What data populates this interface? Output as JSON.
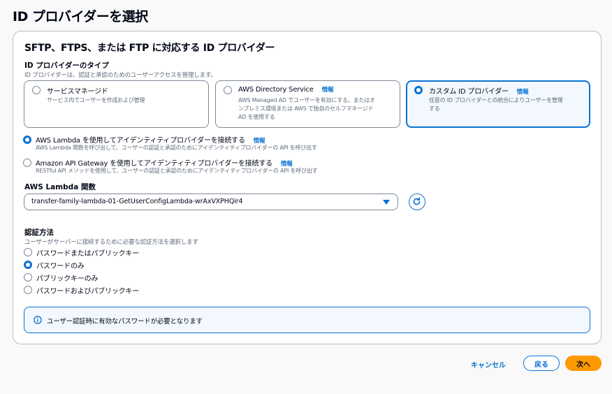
{
  "page": {
    "title": "ID プロバイダーを選択"
  },
  "panel": {
    "title": "SFTP、FTPS、または FTP に対応する ID プロバイダー"
  },
  "provider_type": {
    "label": "ID プロバイダーのタイプ",
    "description": "ID プロバイダーは、認証と承認のためのユーザーアクセスを管理します。",
    "cards": [
      {
        "title": "サービスマネージド",
        "info": "",
        "desc_lines": [
          "サービス内でユーザーを作成および管理"
        ],
        "selected": false
      },
      {
        "title": "AWS Directory Service",
        "info": "情報",
        "desc_lines": [
          "AWS Managed AD でユーザーを有効にする、またはオ",
          "ンプレミス環境または AWS で独自のセルフマネージド",
          "AD を使用する"
        ],
        "selected": false
      },
      {
        "title": "カスタム ID プロバイダー",
        "info": "情報",
        "desc_lines": [
          "任意の ID プロバイダーとの統合によりユーザーを管理",
          "する"
        ],
        "selected": true
      }
    ]
  },
  "connection_options": [
    {
      "title": "AWS Lambda を使用してアイデンティティプロバイダーを接続する",
      "info": "情報",
      "desc": "AWS Lambda 関数を呼び出して、ユーザーの認証と承認のためにアイデンティティプロバイダーの API を呼び出す",
      "selected": true
    },
    {
      "title": "Amazon API Gateway を使用してアイデンティティプロバイダーを接続する",
      "info": "情報",
      "desc": "RESTful API メソッドを使用して、ユーザーの認証と承認のためにアイデンティティプロバイダーの API を呼び出す",
      "selected": false
    }
  ],
  "lambda": {
    "label": "AWS Lambda 関数",
    "selected_value": "transfer-family-lambda-01-GetUserConfigLambda-wrAxVXPHQir4"
  },
  "auth_method": {
    "label": "認証方法",
    "description": "ユーザーがサーバーに接続するために必要な認証方法を選択します",
    "options": [
      {
        "label": "パスワードまたはパブリックキー",
        "selected": false
      },
      {
        "label": "パスワードのみ",
        "selected": true
      },
      {
        "label": "パブリックキーのみ",
        "selected": false
      },
      {
        "label": "パスワードおよびパブリックキー",
        "selected": false
      }
    ]
  },
  "alert": {
    "text": "ユーザー認証時に有効なパスワードが必要となります",
    "icon": "info-icon"
  },
  "footer": {
    "cancel": "キャンセル",
    "back": "戻る",
    "next": "次へ"
  },
  "colors": {
    "accent": "#0972d3",
    "primary_button": "#ff9900",
    "border": "#7d8998"
  }
}
